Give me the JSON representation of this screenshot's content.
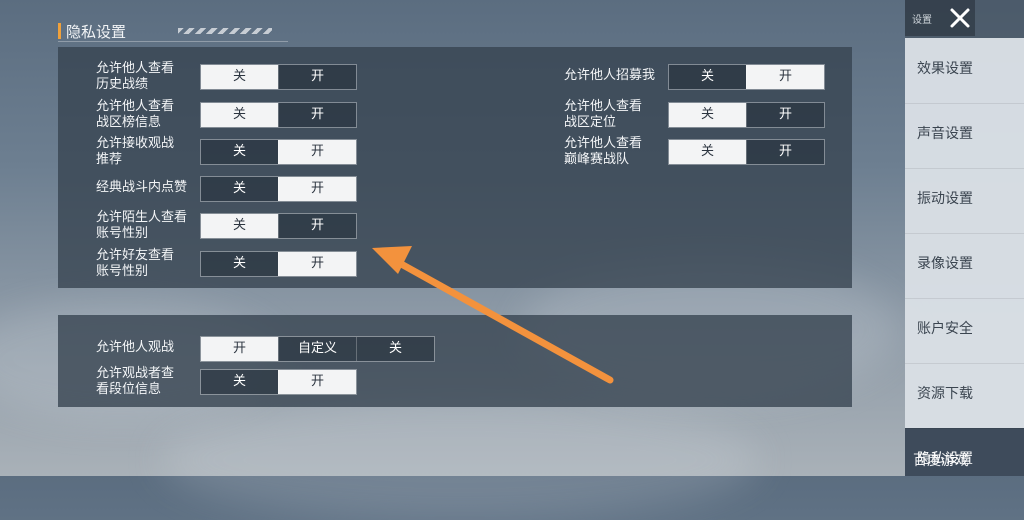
{
  "section": {
    "title": "隐私设置"
  },
  "panel1": {
    "left": [
      {
        "label": "允许他人查看\n历史战绩",
        "options": [
          "关",
          "开"
        ],
        "selected": 0
      },
      {
        "label": "允许他人查看\n战区榜信息",
        "options": [
          "关",
          "开"
        ],
        "selected": 0
      },
      {
        "label": "允许接收观战\n推荐",
        "options": [
          "关",
          "开"
        ],
        "selected": 1
      },
      {
        "label": "经典战斗内点赞",
        "options": [
          "关",
          "开"
        ],
        "selected": 1
      },
      {
        "label": "允许陌生人查看\n账号性别",
        "options": [
          "关",
          "开"
        ],
        "selected": 0
      },
      {
        "label": "允许好友查看\n账号性别",
        "options": [
          "关",
          "开"
        ],
        "selected": 1
      }
    ],
    "right": [
      {
        "label": "允许他人招募我",
        "options": [
          "关",
          "开"
        ],
        "selected": 1
      },
      {
        "label": "允许他人查看\n战区定位",
        "options": [
          "关",
          "开"
        ],
        "selected": 0
      },
      {
        "label": "允许他人查看\n巅峰赛战队",
        "options": [
          "关",
          "开"
        ],
        "selected": 0
      }
    ]
  },
  "panel2": [
    {
      "label": "允许他人观战",
      "options": [
        "开",
        "自定义",
        "关"
      ],
      "selected": 0
    },
    {
      "label": "允许观战者查\n看段位信息",
      "options": [
        "关",
        "开"
      ],
      "selected": 1
    }
  ],
  "sidebar": {
    "header_label": "设置",
    "items": [
      "效果设置",
      "声音设置",
      "振动设置",
      "录像设置",
      "账户安全",
      "资源下载",
      "隐私设置"
    ],
    "active_index": 6
  },
  "watermark": "百度游戏",
  "colors": {
    "accent": "#f0a13b",
    "arrow": "#f3923d",
    "selected_bg": "#f3f4f5"
  },
  "icons": {
    "close": "close-icon",
    "arrow": "arrow-annotation-icon"
  }
}
